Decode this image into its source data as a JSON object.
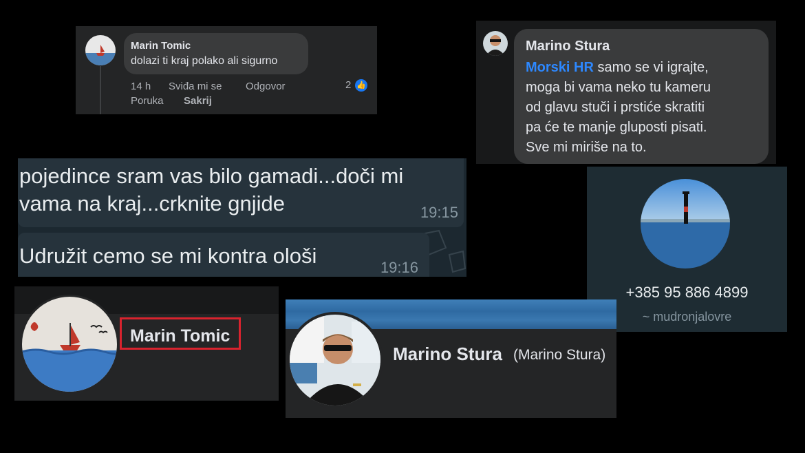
{
  "comment1": {
    "author": "Marin Tomic",
    "text": "dolazi ti kraj polako ali sigurno",
    "time": "14 h",
    "like_action": "Sviđa mi se",
    "reply_action": "Odgovor",
    "reaction_count": "2",
    "message_action": "Poruka",
    "hide_action": "Sakrij",
    "like_color": "#1877f2"
  },
  "comment2": {
    "author": "Marino Stura",
    "mention": "Morski HR",
    "line1_rest": " samo se vi igrajte,",
    "line2": "moga bi vama neko tu kameru",
    "line3": "od glavu stuči i prstiće skratiti",
    "line4": "pa će te manje gluposti pisati.",
    "line5": "Sve mi miriše na to.",
    "mention_color": "#2d88ff"
  },
  "chat": {
    "message1_line1": "pojedince sram vas bilo gamadi...doči mi",
    "message1_line2": "vama na kraj...crknite gnjide",
    "message1_time": "19:15",
    "message2": "Udružit cemo se mi kontra ološi",
    "message2_time": "19:16"
  },
  "contact": {
    "phone": "+385 95 886 4899",
    "username": "~ mudronjalovre"
  },
  "profile1": {
    "name": "Marin Tomic",
    "highlight_color": "#d9232e"
  },
  "profile2": {
    "name": "Marino Stura",
    "alternate_name": "(Marino Stura)"
  }
}
